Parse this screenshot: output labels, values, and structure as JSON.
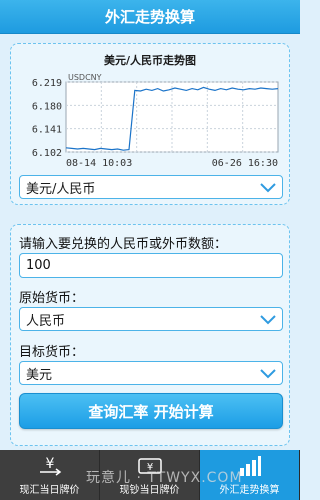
{
  "header": {
    "title": "外汇走势换算"
  },
  "chart_section": {
    "title": "美元/人民币走势图",
    "pair_select": "美元/人民币"
  },
  "chart_data": {
    "type": "line",
    "title": "",
    "legend_code": "USDCNY",
    "x_tick_labels": [
      "08-14 10:03",
      "06-26 16:30"
    ],
    "y_tick_labels": [
      "6.219",
      "6.180",
      "6.141",
      "6.102"
    ],
    "ylim": [
      6.102,
      6.219
    ],
    "grid": true,
    "x": [
      "08-14 10:03",
      "",
      "",
      "",
      "",
      "",
      "",
      "",
      "",
      "",
      "",
      "",
      "",
      "",
      "",
      "",
      "",
      "",
      "",
      "",
      "",
      "",
      "",
      "",
      "",
      "",
      "",
      "",
      "",
      "",
      "",
      "",
      "",
      "",
      "",
      "",
      "",
      "06-26 16:30"
    ],
    "values": [
      6.109,
      6.108,
      6.107,
      6.108,
      6.107,
      6.106,
      6.108,
      6.107,
      6.106,
      6.107,
      6.105,
      6.106,
      6.205,
      6.204,
      6.207,
      6.205,
      6.208,
      6.204,
      6.206,
      6.209,
      6.207,
      6.205,
      6.208,
      6.206,
      6.21,
      6.207,
      6.205,
      6.208,
      6.206,
      6.209,
      6.207,
      6.206,
      6.208,
      6.207,
      6.209,
      6.208,
      6.207,
      6.208
    ],
    "line_color": "#1a73c9"
  },
  "converter": {
    "amount_label": "请输入要兑换的人民币或外币数额：",
    "amount_value": "100",
    "source_label": "原始货币：",
    "source_value": "人民币",
    "target_label": "目标货币：",
    "target_value": "美元",
    "calc_button": "查询汇率 开始计算"
  },
  "tabs": [
    {
      "label": "现汇当日牌价",
      "icon": "yen-exchange-icon"
    },
    {
      "label": "现钞当日牌价",
      "icon": "yen-banknote-icon"
    },
    {
      "label": "外汇走势换算",
      "icon": "bar-chart-icon"
    }
  ],
  "watermark": "玩意儿 · TTWYX.COM",
  "colors": {
    "accent": "#1e9be0",
    "tabbar": "#3e3e3e",
    "background": "#dff0fb"
  }
}
